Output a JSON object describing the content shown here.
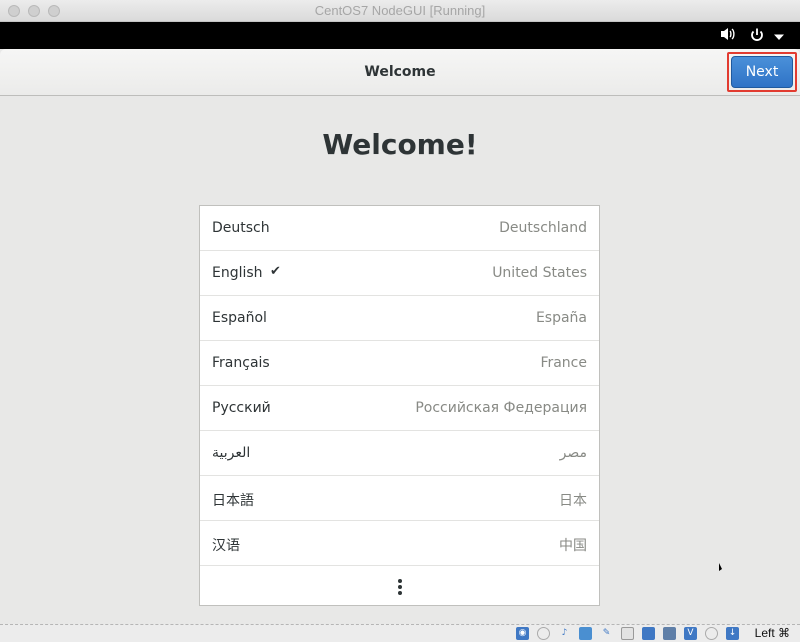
{
  "window": {
    "title": "CentOS7 NodeGUI [Running]"
  },
  "topbar": {
    "icons": [
      "volume-icon",
      "power-icon",
      "dropdown-arrow-icon"
    ]
  },
  "header": {
    "title": "Welcome",
    "next_label": "Next"
  },
  "main": {
    "heading": "Welcome!",
    "languages": [
      {
        "name": "Deutsch",
        "region": "Deutschland",
        "selected": false
      },
      {
        "name": "English",
        "region": "United States",
        "selected": true
      },
      {
        "name": "Español",
        "region": "España",
        "selected": false
      },
      {
        "name": "Français",
        "region": "France",
        "selected": false
      },
      {
        "name": "Русский",
        "region": "Российская Федерация",
        "selected": false
      },
      {
        "name": "العربية",
        "region": "مصر",
        "selected": false
      },
      {
        "name": "日本語",
        "region": "日本",
        "selected": false
      },
      {
        "name": "汉语",
        "region": "中国",
        "selected": false
      }
    ],
    "check_mark": "✔"
  },
  "statusbar": {
    "icons": [
      "hard-disk-icon",
      "optical-disk-icon",
      "audio-icon",
      "network-icon",
      "usb-icon",
      "shared-folder-icon",
      "display-icon",
      "video-capture-icon",
      "virtualization-icon",
      "mouse-integration-icon",
      "keyboard-capture-icon"
    ],
    "host_key": "Left ⌘"
  }
}
